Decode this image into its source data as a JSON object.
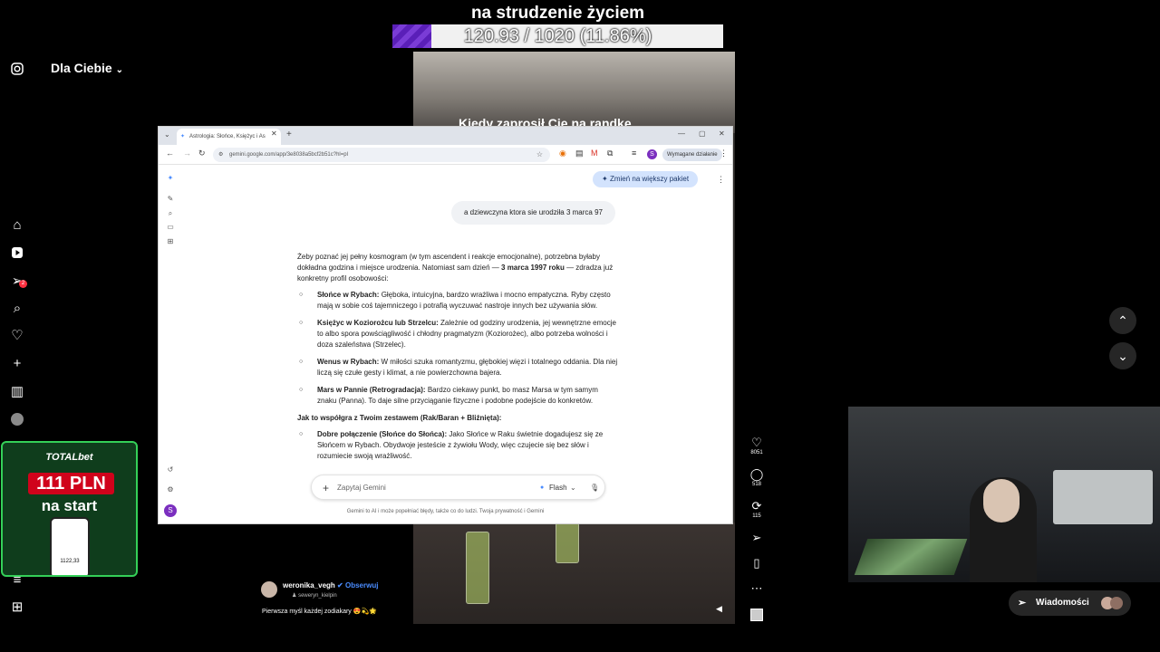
{
  "overlay": {
    "title": "na strudzenie życiem",
    "progress_text": "120.93 / 1020 (11.86%)",
    "progress_fraction": 0.1186
  },
  "nav": {
    "feed_label": "Dla Ciebie",
    "notification_badge": "2"
  },
  "video": {
    "caption": "Kiedy zaprosił Cię na randkę"
  },
  "browser": {
    "tab_title": "Astrologia: Słońce, Księżyc i As",
    "url": "gemini.google.com/app/3e8038a5bcf2b51c?hl=pl",
    "action_required": "Wymagane działanie",
    "profile_initial": "S",
    "upgrade_label": "Zmień na większy pakiet",
    "user_message": "a dziewczyna ktora sie urodziła 3 marca 97",
    "intro_a": "Żeby poznać jej pełny kosmogram (w tym ascendent i reakcje emocjonalne), potrzebna byłaby dokładna godzina i miejsce urodzenia. Natomiast sam dzień — ",
    "intro_bold": "3 marca 1997 roku",
    "intro_b": " — zdradza już konkretny profil osobowości:",
    "items": [
      {
        "title": "Słońce w Rybach:",
        "text": " Głęboka, intuicyjna, bardzo wrażliwa i mocno empatyczna. Ryby często mają w sobie coś tajemniczego i potrafią wyczuwać nastroje innych bez używania słów."
      },
      {
        "title": "Księżyc w Koziorożcu lub Strzelcu:",
        "text": " Zależnie od godziny urodzenia, jej wewnętrzne emocje to albo spora powściągliwość i chłodny pragmatyzm (Koziorożec), albo potrzeba wolności i doza szaleństwa (Strzelec)."
      },
      {
        "title": "Wenus w Rybach:",
        "text": " W miłości szuka romantyzmu, głębokiej więzi i totalnego oddania. Dla niej liczą się czułe gesty i klimat, a nie powierzchowna bajera."
      },
      {
        "title": "Mars w Pannie (Retrogradacja):",
        "text": " Bardzo ciekawy punkt, bo masz Marsa w tym samym znaku (Panna). To daje silne przyciąganie fizyczne i podobne podejście do konkretów."
      }
    ],
    "section_heading": "Jak to współgra z Twoim zestawem (Rak/Baran + Bliźnięta):",
    "items2": [
      {
        "title": "Dobre połączenie (Słońce do Słońca):",
        "text": " Jako Słońce w Raku świetnie dogadujesz się ze Słońcem w Rybach. Obydwoje jesteście z żywiołu Wody, więc czujecie się bez słów i rozumiecie swoją wrażliwość."
      }
    ],
    "ask_placeholder": "Zapytaj Gemini",
    "model_label": "Flash",
    "footer_note": "Gemini to AI i może popełniać błędy, także co do ludzi. Twoja prywatność i Gemini"
  },
  "actions": {
    "likes": "8051",
    "comments": "518",
    "reposts": "115"
  },
  "messages_label": "Wiadomości",
  "ad": {
    "brand": "TOTALbet",
    "amount": "111 PLN",
    "sub": "na start",
    "phone_amount": "1122,33"
  },
  "post": {
    "username": "weronika_vegh",
    "follow_label": "Obserwuj",
    "music": "seweryn_kielpin",
    "caption": "Pierwsza myśl każdej zodiakary 😍💫🌟"
  },
  "colors": {
    "accent_blue": "#4a8cff",
    "progress_purple": "#5a1fb8",
    "ad_green": "#34d058"
  }
}
